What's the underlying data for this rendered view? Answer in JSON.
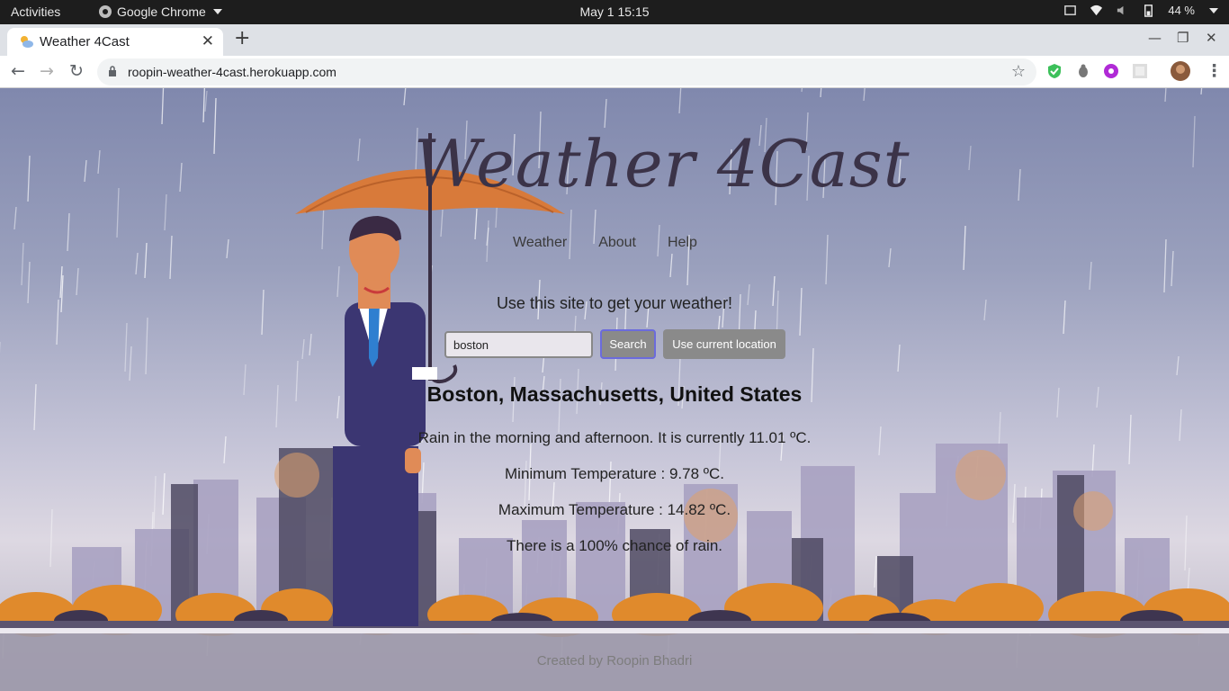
{
  "system_bar": {
    "activities": "Activities",
    "app_name": "Google Chrome",
    "clock": "May 1  15:15",
    "battery": "44 %"
  },
  "browser": {
    "tab_title": "Weather 4Cast",
    "url": "roopin-weather-4cast.herokuapp.com",
    "new_tab_glyph": "+",
    "close_glyph": "✕"
  },
  "page": {
    "logo": "Weather 4Cast",
    "nav": [
      "Weather",
      "About",
      "Help"
    ],
    "intro": "Use this site to get your weather!",
    "search_value": "boston",
    "search_button": "Search",
    "location_button": "Use current location",
    "location": "Boston, Massachusetts, United States",
    "forecast": "Rain in the morning and afternoon. It is currently 11.01 ºC.",
    "min_temp": "Minimum Temperature : 9.78 ºC.",
    "max_temp": "Maximum Temperature : 14.82 ºC.",
    "rain_chance": "There is a 100% chance of rain.",
    "footer": "Created by Roopin Bhadri"
  },
  "colors": {
    "accent_umbrella": "#d87a3a",
    "title_color": "#3b3348",
    "button_gray": "#8a8a8a"
  }
}
